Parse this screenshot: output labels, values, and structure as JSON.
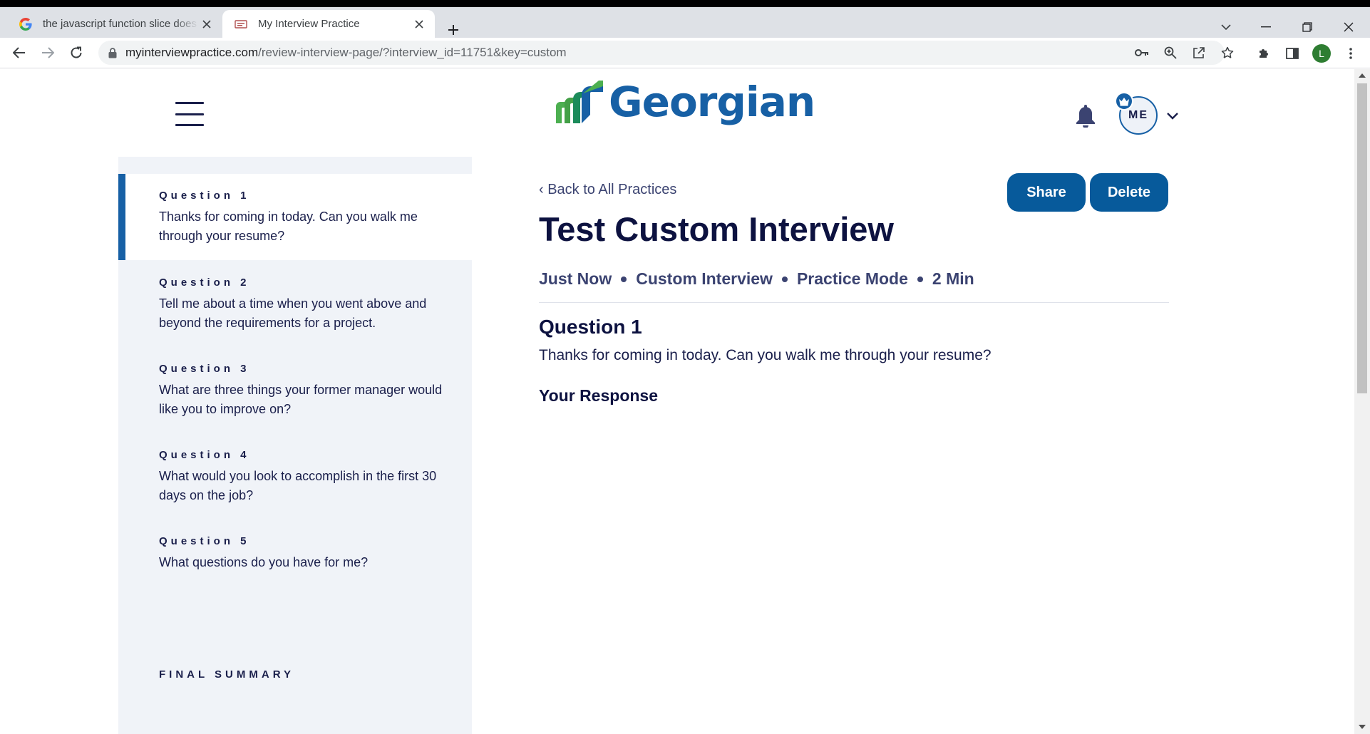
{
  "browser": {
    "tabs": [
      {
        "title": "the javascript function slice does",
        "favicon": "google-icon",
        "active": false
      },
      {
        "title": "My Interview Practice",
        "favicon": "site-icon",
        "active": true
      }
    ],
    "url_domain": "myinterviewpractice.com",
    "url_path": "/review-interview-page/?interview_id=11751&key=custom",
    "profile_initial": "L"
  },
  "header": {
    "logo_text": "Georgian",
    "avatar_initials": "ME"
  },
  "sidebar": {
    "questions": [
      {
        "label": "Question 1",
        "text": "Thanks for coming in today. Can you walk me through your resume?",
        "active": true
      },
      {
        "label": "Question 2",
        "text": "Tell me about a time when you went above and beyond the requirements for a project.",
        "active": false
      },
      {
        "label": "Question 3",
        "text": "What are three things your former manager would like you to improve on?",
        "active": false
      },
      {
        "label": "Question 4",
        "text": "What would you look to accomplish in the first 30 days on the job?",
        "active": false
      },
      {
        "label": "Question 5",
        "text": "What questions do you have for me?",
        "active": false
      }
    ],
    "final_summary": "FINAL SUMMARY"
  },
  "main": {
    "back_link": "Back to All Practices",
    "share_label": "Share",
    "delete_label": "Delete",
    "title": "Test Custom Interview",
    "meta": [
      "Just Now",
      "Custom Interview",
      "Practice Mode",
      "2 Min"
    ],
    "question_heading": "Question 1",
    "question_text": "Thanks for coming in today. Can you walk me through your resume?",
    "response_heading": "Your Response"
  },
  "colors": {
    "brand_blue": "#1760a5",
    "button_blue": "#075a9b",
    "navy_text": "#0d1240",
    "sidebar_bg": "#f0f3f8",
    "logo_green": "#4caf50"
  }
}
